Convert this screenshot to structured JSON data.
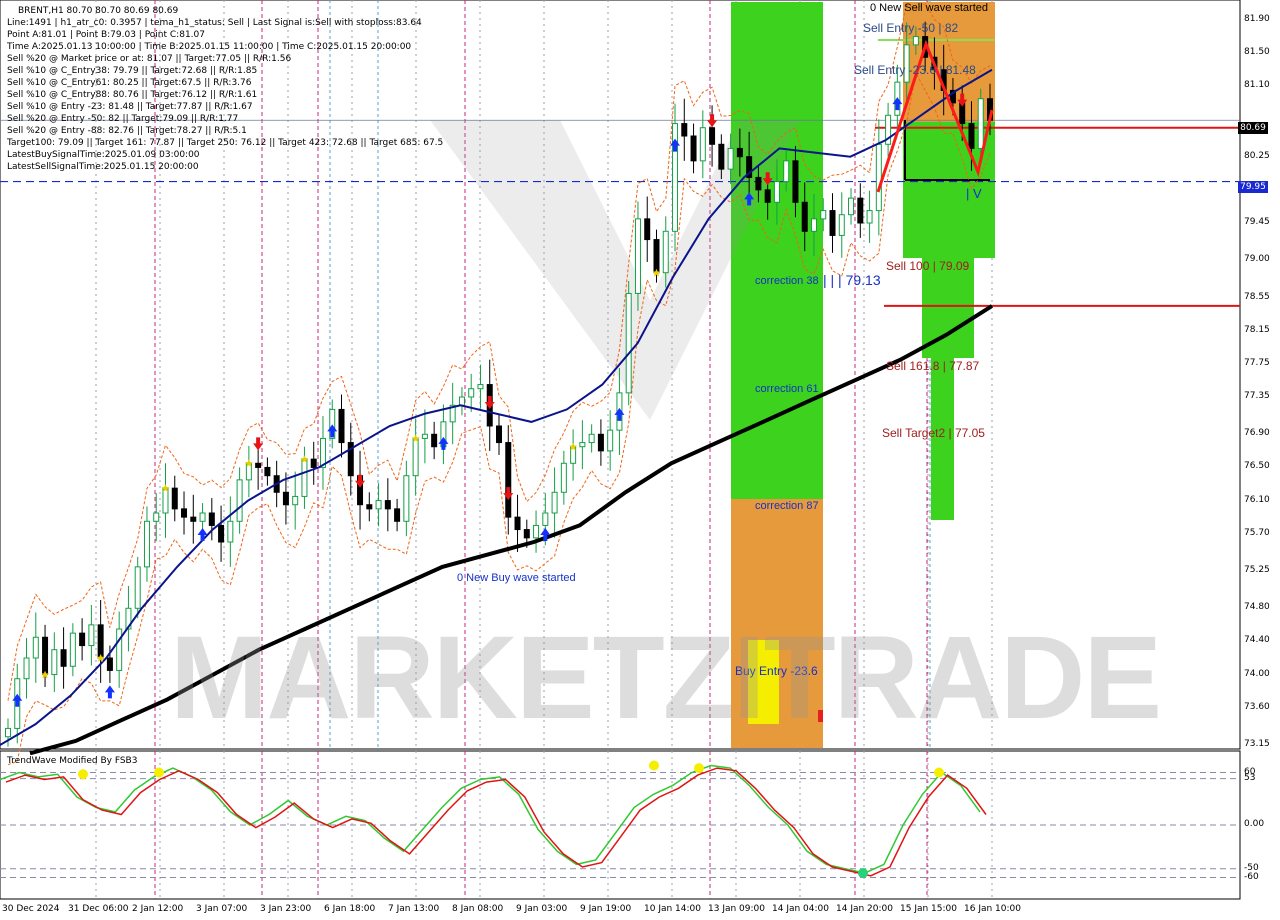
{
  "info_lines": [
    "BRENT,H1  80.70 80.70 80.69 80.69",
    "Line:1491 | h1_atr_c0: 0.3957 | tema_h1_status: Sell | Last Signal is:Sell with stoploss:83.64",
    "Point A:81.01 | Point B:79.03 | Point C:81.07",
    "Time A:2025.01.13 10:00:00 | Time B:2025.01.15 11:00:00 | Time C:2025.01.15 20:00:00",
    "Sell %20 @ Market price or at: 81.07 || Target:77.05 || R/R:1.56",
    "Sell %10 @ C_Entry38: 79.79 || Target:72.68 || R/R:1.85",
    "Sell %10 @ C_Entry61: 80.25 || Target:67.5 || R/R:3.76",
    "Sell %10 @ C_Entry88: 80.76 || Target:76.12 || R/R:1.61",
    "Sell %10 @ Entry -23: 81.48 || Target:77.87 || R/R:1.67",
    "Sell %20 @ Entry -50: 82 || Target:79.09 || R/R:1.77",
    "Sell %20 @ Entry -88: 82.76 || Target:78.27 || R/R:5.1",
    "Target100: 79.09 || Target 161: 77.87 || Target 250: 76.12 || Target 423: 72.68 || Target 685: 67.5",
    "LatestBuySignalTime:2025.01.09 03:00:00",
    "LatestSellSignalTime:2025.01.15 20:00:00"
  ],
  "labels": {
    "new_sell_wave": "0 New Sell wave started",
    "new_buy_wave": "0 New Buy wave started",
    "sell_entry_50": "Sell Entry -50 | 82",
    "sell_entry_23": "Sell Entry -23.6 | 81.48",
    "sell_100": "Sell 100 | 79.09",
    "sell_161": "Sell 161.8 | 77.87",
    "sell_target2": "Sell Target2 | 77.05",
    "correction_38": "correction 38",
    "correction_38_value": "| | | 79.13",
    "correction_61": "correction 61",
    "correction_87": "correction 87",
    "buy_entry": "Buy Entry -23.6",
    "sell_marks": "| V",
    "watermark": "MARKETZITRADE"
  },
  "indicator": {
    "title": "TrendWave Modified By FSB3",
    "levels": [
      "60",
      "53",
      "0.00",
      "-50",
      "-60"
    ]
  },
  "colors": {
    "up_candle": "#14a046",
    "down_candle": "#000000",
    "ma_fast": "#0a148c",
    "ma_slow": "#000000",
    "zone_green": "#3cd21e",
    "zone_orange": "#e69a3c",
    "sell_line": "#e01414",
    "buy_arrow": "#1432ff",
    "sell_arrow": "#e61414",
    "envelope": "#f06414",
    "current_price_tag": "#000000",
    "level_tag": "#1a28d2"
  },
  "chart_data": {
    "type": "candlestick",
    "symbol": "BRENT,H1",
    "ohlc_last": [
      80.7,
      80.7,
      80.69,
      80.69
    ],
    "ylim": [
      73.15,
      81.9
    ],
    "y_ticks": [
      "81.90",
      "81.50",
      "81.10",
      "80.69",
      "80.25",
      "79.95",
      "79.45",
      "79.00",
      "78.55",
      "78.15",
      "77.75",
      "77.35",
      "76.90",
      "76.50",
      "76.10",
      "75.70",
      "75.25",
      "74.80",
      "74.40",
      "74.00",
      "73.60",
      "73.15"
    ],
    "x_ticks": [
      "30 Dec 2024",
      "31 Dec 06:00",
      "2 Jan 12:00",
      "3 Jan 07:00",
      "3 Jan 23:00",
      "6 Jan 18:00",
      "7 Jan 13:00",
      "8 Jan 08:00",
      "9 Jan 03:00",
      "9 Jan 19:00",
      "10 Jan 14:00",
      "13 Jan 09:00",
      "14 Jan 04:00",
      "14 Jan 20:00",
      "15 Jan 15:00",
      "16 Jan 10:00"
    ],
    "current_price": 80.69,
    "dashed_level": 79.95,
    "sell_line_1": 80.6,
    "sell_line_2": 78.45,
    "close_path": [
      73.35,
      73.95,
      74.2,
      74.45,
      74.0,
      74.3,
      74.1,
      74.5,
      74.35,
      74.6,
      74.2,
      74.05,
      74.55,
      74.8,
      75.3,
      75.85,
      75.95,
      76.25,
      76.0,
      75.9,
      75.85,
      75.95,
      75.8,
      75.6,
      75.85,
      76.35,
      76.55,
      76.5,
      76.4,
      76.2,
      76.05,
      76.15,
      76.6,
      76.5,
      76.85,
      77.2,
      76.8,
      76.4,
      76.05,
      76.0,
      76.1,
      76.0,
      75.85,
      76.4,
      76.85,
      76.9,
      76.75,
      77.05,
      77.25,
      77.35,
      77.45,
      77.5,
      77.0,
      76.8,
      75.9,
      75.75,
      75.65,
      75.8,
      75.95,
      76.2,
      76.55,
      76.75,
      76.8,
      76.9,
      76.7,
      76.95,
      77.4,
      78.6,
      79.5,
      79.25,
      78.85,
      79.35,
      80.65,
      80.5,
      80.2,
      80.6,
      80.4,
      80.1,
      80.35,
      80.25,
      80.0,
      79.85,
      79.7,
      79.95,
      80.2,
      79.7,
      79.35,
      79.5,
      79.6,
      79.3,
      79.55,
      79.75,
      79.45,
      79.6,
      80.4,
      80.75,
      81.15,
      81.6,
      81.7,
      81.45,
      81.3,
      81.05,
      80.9,
      80.65,
      80.35,
      80.95,
      80.69
    ],
    "ma_fast_path": [
      73.15,
      73.4,
      73.75,
      74.2,
      74.8,
      75.3,
      75.75,
      76.1,
      76.35,
      76.5,
      76.75,
      77.0,
      77.15,
      77.25,
      77.15,
      77.05,
      77.2,
      77.5,
      78.0,
      78.8,
      79.5,
      80.0,
      80.35,
      80.3,
      80.25,
      80.45,
      80.75,
      81.05,
      81.3
    ],
    "ma_slow_path": [
      73.05,
      73.2,
      73.45,
      73.7,
      74.0,
      74.3,
      74.55,
      74.8,
      75.05,
      75.3,
      75.45,
      75.6,
      75.8,
      76.2,
      76.55,
      76.8,
      77.05,
      77.3,
      77.55,
      77.8,
      78.1,
      78.45
    ],
    "indicator_series": {
      "range": [
        -80,
        80
      ],
      "values": [
        52,
        60,
        55,
        58,
        32,
        20,
        15,
        40,
        55,
        65,
        55,
        40,
        15,
        0,
        12,
        28,
        10,
        0,
        10,
        5,
        -15,
        -30,
        -5,
        20,
        42,
        52,
        55,
        35,
        -5,
        -30,
        -45,
        -40,
        -10,
        20,
        35,
        45,
        60,
        68,
        65,
        45,
        20,
        0,
        -30,
        -45,
        -50,
        -55,
        -45,
        0,
        35,
        60,
        45,
        15
      ]
    }
  }
}
